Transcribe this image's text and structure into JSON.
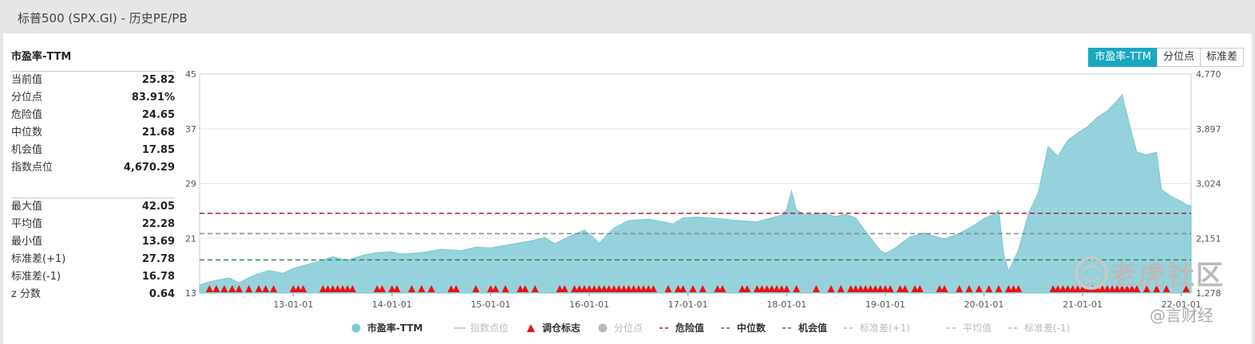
{
  "window_title": "标普500 (SPX.GI) - 历史PE/PB",
  "section_title": "市盈率-TTM",
  "stats_top": [
    {
      "label": "当前值",
      "value": "25.82"
    },
    {
      "label": "分位点",
      "value": "83.91%"
    },
    {
      "label": "危险值",
      "value": "24.65"
    },
    {
      "label": "中位数",
      "value": "21.68"
    },
    {
      "label": "机会值",
      "value": "17.85"
    },
    {
      "label": "指数点位",
      "value": "4,670.29"
    }
  ],
  "stats_bottom": [
    {
      "label": "最大值",
      "value": "42.05"
    },
    {
      "label": "平均值",
      "value": "22.28"
    },
    {
      "label": "最小值",
      "value": "13.69"
    },
    {
      "label": "标准差(+1)",
      "value": "27.78"
    },
    {
      "label": "标准差(-1)",
      "value": "16.78"
    },
    {
      "label": "z 分数",
      "value": "0.64"
    }
  ],
  "buttons": [
    "市盈率-TTM",
    "分位点",
    "标准差"
  ],
  "watermark": {
    "brand": "老虎社区",
    "sub": "@言财经"
  },
  "colors": {
    "area": "#95d2db",
    "area_line": "#7cc7d2",
    "danger": "#b22222",
    "median": "#888888",
    "opportunity": "#2e8b57",
    "marker": "#ee1111",
    "accent": "#1aa8c1"
  },
  "chart_data": {
    "type": "area",
    "title": "",
    "ylim_left": [
      13,
      45
    ],
    "yticks_left": [
      "45",
      "37",
      "29",
      "21",
      "13"
    ],
    "ylim_right": [
      1278,
      4770
    ],
    "yticks_right": [
      "4,770",
      "3,897",
      "3,024",
      "2,151",
      "1,278"
    ],
    "xticks": [
      "13-01-01",
      "14-01-01",
      "15-01-01",
      "16-01-01",
      "17-01-01",
      "18-01-01",
      "19-01-01",
      "20-01-01",
      "21-01-01",
      "22-01-01"
    ],
    "x_range": [
      2012.05,
      2022.1
    ],
    "reference_lines": {
      "danger": 24.65,
      "median": 21.68,
      "opportunity": 17.85
    },
    "series": [
      {
        "name": "市盈率-TTM",
        "points": [
          [
            2012.05,
            14.2
          ],
          [
            2012.2,
            14.8
          ],
          [
            2012.35,
            15.2
          ],
          [
            2012.45,
            14.5
          ],
          [
            2012.6,
            15.6
          ],
          [
            2012.75,
            16.3
          ],
          [
            2012.9,
            15.9
          ],
          [
            2013.0,
            16.6
          ],
          [
            2013.2,
            17.4
          ],
          [
            2013.4,
            18.3
          ],
          [
            2013.55,
            17.8
          ],
          [
            2013.7,
            18.5
          ],
          [
            2013.85,
            18.9
          ],
          [
            2014.0,
            19.0
          ],
          [
            2014.1,
            18.7
          ],
          [
            2014.3,
            18.9
          ],
          [
            2014.5,
            19.4
          ],
          [
            2014.7,
            19.2
          ],
          [
            2014.85,
            19.7
          ],
          [
            2015.0,
            19.6
          ],
          [
            2015.2,
            20.1
          ],
          [
            2015.4,
            20.6
          ],
          [
            2015.55,
            21.1
          ],
          [
            2015.65,
            20.2
          ],
          [
            2015.8,
            21.3
          ],
          [
            2015.95,
            22.2
          ],
          [
            2016.05,
            21.0
          ],
          [
            2016.1,
            20.3
          ],
          [
            2016.25,
            22.5
          ],
          [
            2016.4,
            23.6
          ],
          [
            2016.6,
            23.8
          ],
          [
            2016.75,
            23.4
          ],
          [
            2016.85,
            23.1
          ],
          [
            2016.95,
            24.0
          ],
          [
            2017.1,
            24.1
          ],
          [
            2017.3,
            23.9
          ],
          [
            2017.5,
            23.6
          ],
          [
            2017.7,
            23.4
          ],
          [
            2017.85,
            24.0
          ],
          [
            2017.95,
            24.4
          ],
          [
            2018.0,
            25.2
          ],
          [
            2018.05,
            27.9
          ],
          [
            2018.1,
            25.1
          ],
          [
            2018.2,
            24.4
          ],
          [
            2018.35,
            24.7
          ],
          [
            2018.5,
            24.2
          ],
          [
            2018.6,
            24.5
          ],
          [
            2018.7,
            24.0
          ],
          [
            2018.8,
            22.0
          ],
          [
            2018.95,
            19.2
          ],
          [
            2019.0,
            18.8
          ],
          [
            2019.1,
            19.6
          ],
          [
            2019.25,
            21.2
          ],
          [
            2019.4,
            21.8
          ],
          [
            2019.5,
            21.3
          ],
          [
            2019.6,
            20.9
          ],
          [
            2019.75,
            21.7
          ],
          [
            2019.9,
            22.9
          ],
          [
            2020.0,
            23.9
          ],
          [
            2020.1,
            24.5
          ],
          [
            2020.15,
            25.1
          ],
          [
            2020.2,
            18.7
          ],
          [
            2020.25,
            16.2
          ],
          [
            2020.35,
            19.3
          ],
          [
            2020.45,
            24.6
          ],
          [
            2020.55,
            27.6
          ],
          [
            2020.65,
            34.4
          ],
          [
            2020.75,
            33.0
          ],
          [
            2020.85,
            35.3
          ],
          [
            2020.95,
            36.4
          ],
          [
            2021.05,
            37.3
          ],
          [
            2021.15,
            38.7
          ],
          [
            2021.25,
            39.6
          ],
          [
            2021.35,
            41.1
          ],
          [
            2021.4,
            42.0
          ],
          [
            2021.5,
            36.2
          ],
          [
            2021.55,
            33.6
          ],
          [
            2021.65,
            33.2
          ],
          [
            2021.75,
            33.6
          ],
          [
            2021.8,
            28.1
          ],
          [
            2021.9,
            27.1
          ],
          [
            2022.0,
            26.4
          ],
          [
            2022.05,
            25.9
          ],
          [
            2022.1,
            25.8
          ]
        ]
      }
    ],
    "rebalance_markers": [
      2012.15,
      2012.22,
      2012.3,
      2012.38,
      2012.45,
      2012.55,
      2012.65,
      2012.72,
      2012.8,
      2013.0,
      2013.05,
      2013.1,
      2013.3,
      2013.35,
      2013.4,
      2013.45,
      2013.5,
      2013.55,
      2013.6,
      2013.85,
      2013.9,
      2014.0,
      2014.05,
      2014.2,
      2014.3,
      2014.4,
      2014.6,
      2014.65,
      2014.85,
      2015.0,
      2015.05,
      2015.15,
      2015.3,
      2015.35,
      2015.45,
      2015.7,
      2015.75,
      2015.85,
      2015.9,
      2015.95,
      2016.0,
      2016.05,
      2016.1,
      2016.15,
      2016.2,
      2016.25,
      2016.3,
      2016.35,
      2016.4,
      2016.45,
      2016.5,
      2016.55,
      2016.6,
      2016.65,
      2016.8,
      2016.9,
      2016.95,
      2017.05,
      2017.15,
      2017.3,
      2017.35,
      2017.55,
      2017.6,
      2017.7,
      2017.75,
      2017.8,
      2017.85,
      2017.9,
      2017.95,
      2018.0,
      2018.1,
      2018.3,
      2018.45,
      2018.55,
      2018.65,
      2018.7,
      2018.75,
      2018.8,
      2018.85,
      2018.9,
      2018.95,
      2019.0,
      2019.05,
      2019.15,
      2019.2,
      2019.3,
      2019.35,
      2019.55,
      2019.6,
      2019.75,
      2019.85,
      2019.95,
      2020.05,
      2020.15,
      2020.25,
      2020.3,
      2020.35,
      2020.7,
      2020.75,
      2020.8,
      2020.85,
      2020.9,
      2020.95,
      2021.0,
      2021.05,
      2021.1,
      2021.15,
      2021.2,
      2021.25,
      2021.3,
      2021.35,
      2021.4,
      2021.45,
      2021.5,
      2021.55,
      2021.65,
      2021.75,
      2021.85,
      2022.05
    ],
    "legend": [
      {
        "label": "市盈率-TTM",
        "type": "circle",
        "color": "#7ec8d4",
        "active": true
      },
      {
        "label": "指数点位",
        "type": "line",
        "color": "#bbbbbb",
        "active": false
      },
      {
        "label": "调仓标志",
        "type": "triangle",
        "color": "#ee1111",
        "active": true
      },
      {
        "label": "分位点",
        "type": "circle",
        "color": "#bbbbbb",
        "active": false
      },
      {
        "label": "危险值",
        "type": "dash",
        "color": "#b22222",
        "active": true
      },
      {
        "label": "中位数",
        "type": "dash",
        "color": "#666666",
        "active": true
      },
      {
        "label": "机会值",
        "type": "dash",
        "color": "#2e8b57",
        "active": true
      },
      {
        "label": "标准差(+1)",
        "type": "dash",
        "color": "#bbbbbb",
        "active": false
      },
      {
        "label": "平均值",
        "type": "dash",
        "color": "#bbbbbb",
        "active": false
      },
      {
        "label": "标准差(-1)",
        "type": "dash",
        "color": "#bbbbbb",
        "active": false
      }
    ]
  }
}
